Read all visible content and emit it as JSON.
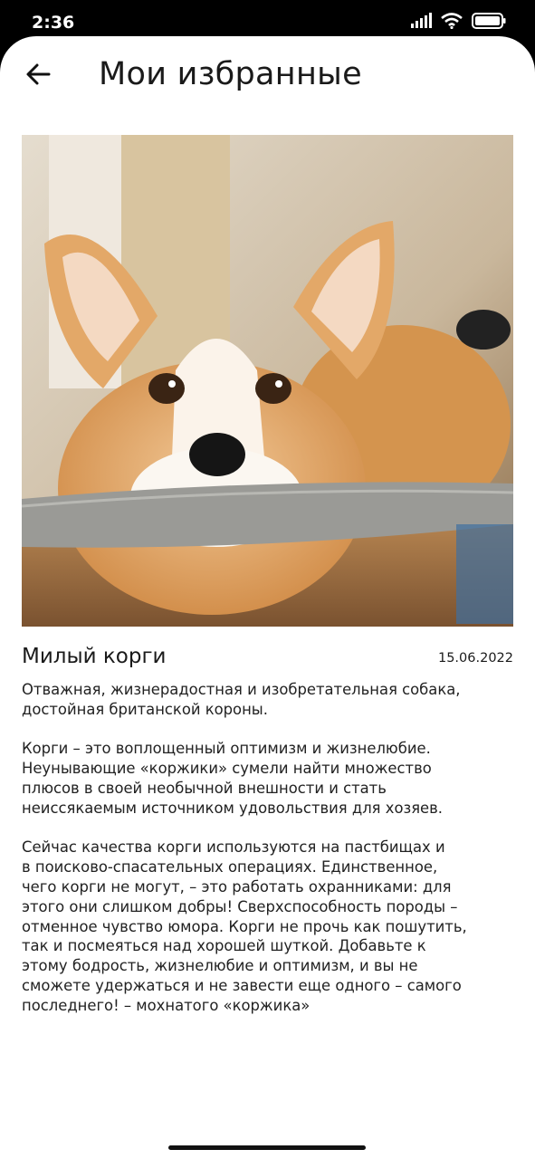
{
  "status_bar": {
    "time": "2:36"
  },
  "header": {
    "title": "Мои избранные"
  },
  "photo": {
    "description": "corgi"
  },
  "card": {
    "title": "Милый корги",
    "date": "15.06.2022",
    "body": "Отважная, жизнерадостная и изобретательная собака,\nдостойная британской короны.\n\nКорги – это воплощенный оптимизм и жизнелюбие.\nНеунывающие «коржики» сумели найти множество\nплюсов в своей необычной внешности и стать\nнеиссякаемым источником удовольствия для хозяев.\n\nСейчас качества корги используются на пастбищах и\nв поисково-спасательных операциях. Единственное,\nчего корги не могут, – это работать охранниками: для\nэтого они слишком добры! Сверхспособность породы –\nотменное чувство юмора. Корги не прочь как пошутить,\nтак и посмеяться над хорошей шуткой. Добавьте к\nэтому бодрость, жизнелюбие и оптимизм, и вы не\nсможете удержаться и не завести еще одного – самого\nпоследнего! – мохнатого «коржика»"
  }
}
